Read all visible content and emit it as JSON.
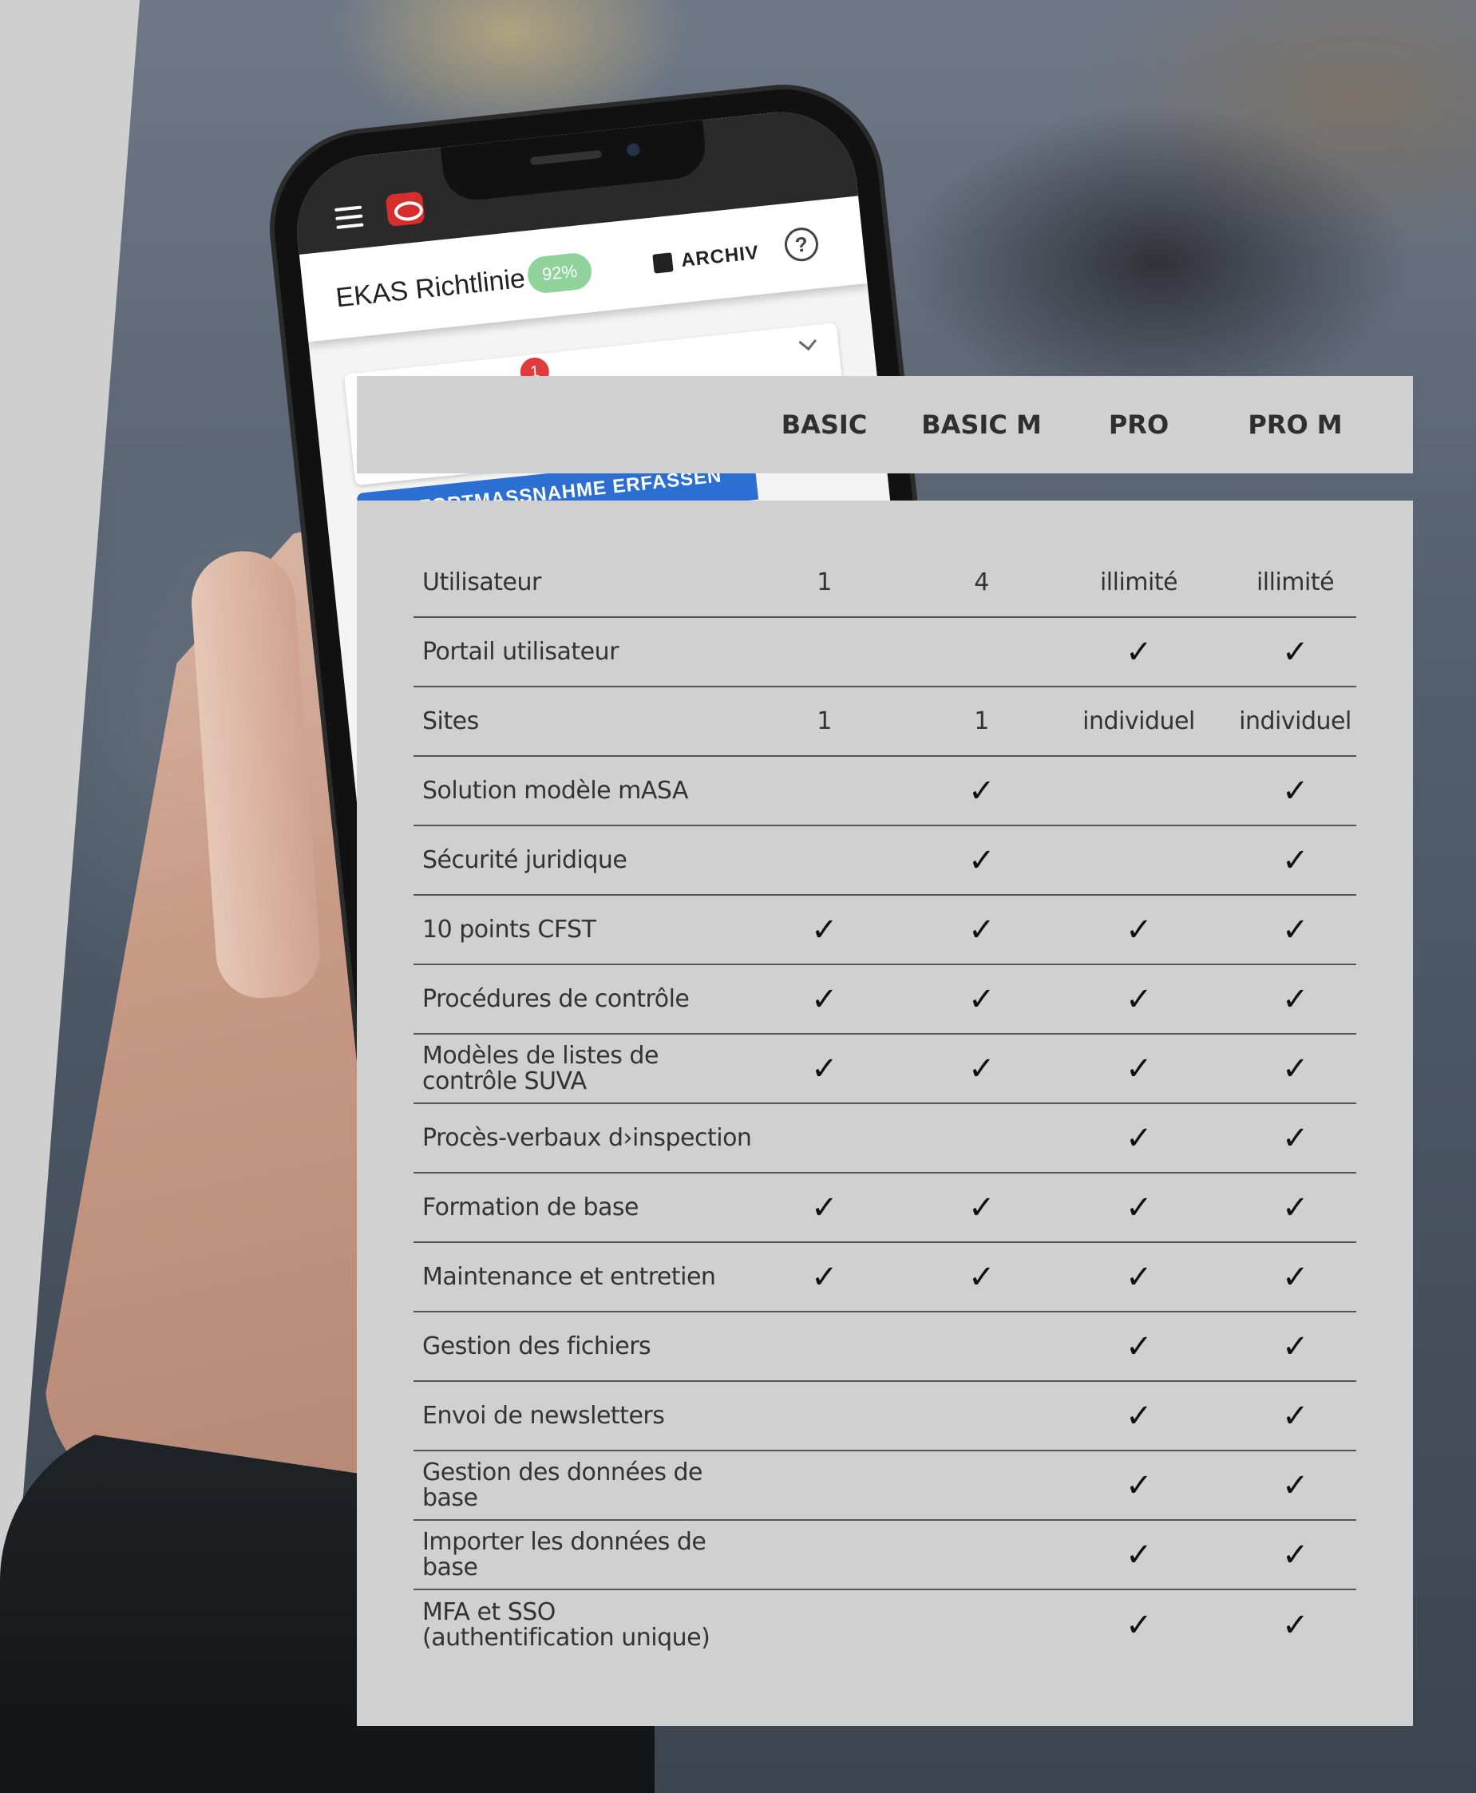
{
  "phone_app": {
    "title": "EKAS Richtlinie",
    "progress": "92%",
    "archive_label": "ARCHIV",
    "help_symbol": "?",
    "notification_count": "1",
    "action_button_label": "SOFORTMASSNAHME ERFASSEN"
  },
  "plans": [
    "BASIC",
    "BASIC M",
    "PRO",
    "PRO M"
  ],
  "check_symbol": "✓",
  "features": [
    {
      "label": "Utilisateur",
      "values": [
        "1",
        "4",
        "illimité",
        "illimité"
      ]
    },
    {
      "label": "Portail utilisateur",
      "values": [
        "",
        "",
        "✓",
        "✓"
      ]
    },
    {
      "label": "Sites",
      "values": [
        "1",
        "1",
        "individuel",
        "individuel"
      ]
    },
    {
      "label": "Solution modèle mASA",
      "values": [
        "",
        "✓",
        "",
        "✓"
      ]
    },
    {
      "label": "Sécurité juridique",
      "values": [
        "",
        "✓",
        "",
        "✓"
      ]
    },
    {
      "label": "10 points CFST",
      "values": [
        "✓",
        "✓",
        "✓",
        "✓"
      ]
    },
    {
      "label": "Procédures de contrôle",
      "values": [
        "✓",
        "✓",
        "✓",
        "✓"
      ]
    },
    {
      "label": "Modèles de listes de contrôle SUVA",
      "values": [
        "✓",
        "✓",
        "✓",
        "✓"
      ]
    },
    {
      "label": "Procès-verbaux d›inspection",
      "values": [
        "",
        "",
        "✓",
        "✓"
      ]
    },
    {
      "label": "Formation de base",
      "values": [
        "✓",
        "✓",
        "✓",
        "✓"
      ]
    },
    {
      "label": "Maintenance et entretien",
      "values": [
        "✓",
        "✓",
        "✓",
        "✓"
      ]
    },
    {
      "label": "Gestion des fichiers",
      "values": [
        "",
        "",
        "✓",
        "✓"
      ]
    },
    {
      "label": "Envoi de newsletters",
      "values": [
        "",
        "",
        "✓",
        "✓"
      ]
    },
    {
      "label": "Gestion des données de base",
      "values": [
        "",
        "",
        "✓",
        "✓"
      ]
    },
    {
      "label": "Importer les données de base",
      "values": [
        "",
        "",
        "✓",
        "✓"
      ]
    },
    {
      "label": "MFA et SSO\n(authentification unique)",
      "values": [
        "",
        "",
        "✓",
        "✓"
      ]
    }
  ]
}
